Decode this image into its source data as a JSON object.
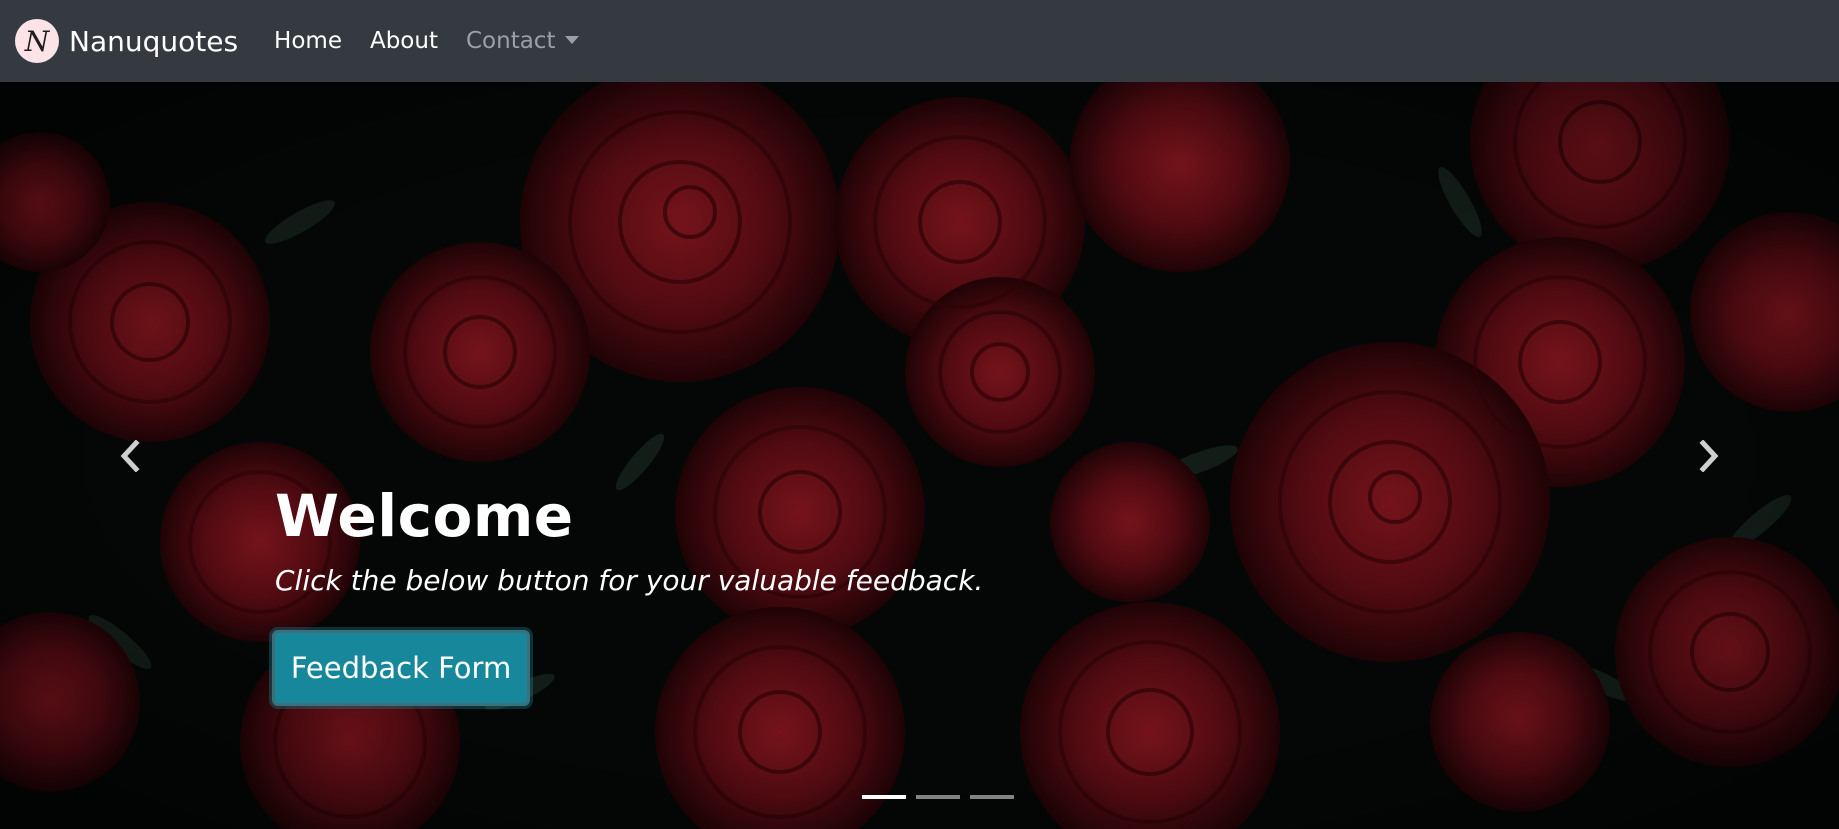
{
  "navbar": {
    "brand_initial": "N",
    "brand_name": "Nanuquotes",
    "links": [
      {
        "label": "Home"
      },
      {
        "label": "About"
      },
      {
        "label": "Contact"
      }
    ]
  },
  "hero": {
    "title": "Welcome",
    "subtitle": "Click the below button for your valuable feedback.",
    "button_label": "Feedback Form",
    "slides": 3,
    "active_slide": 1
  },
  "icons": {
    "prev": "chevron-left-icon",
    "next": "chevron-right-icon",
    "caret": "caret-down-icon"
  },
  "colors": {
    "navbar": "#343a40",
    "button": "#17889c",
    "rose": "#8b0f1a"
  }
}
